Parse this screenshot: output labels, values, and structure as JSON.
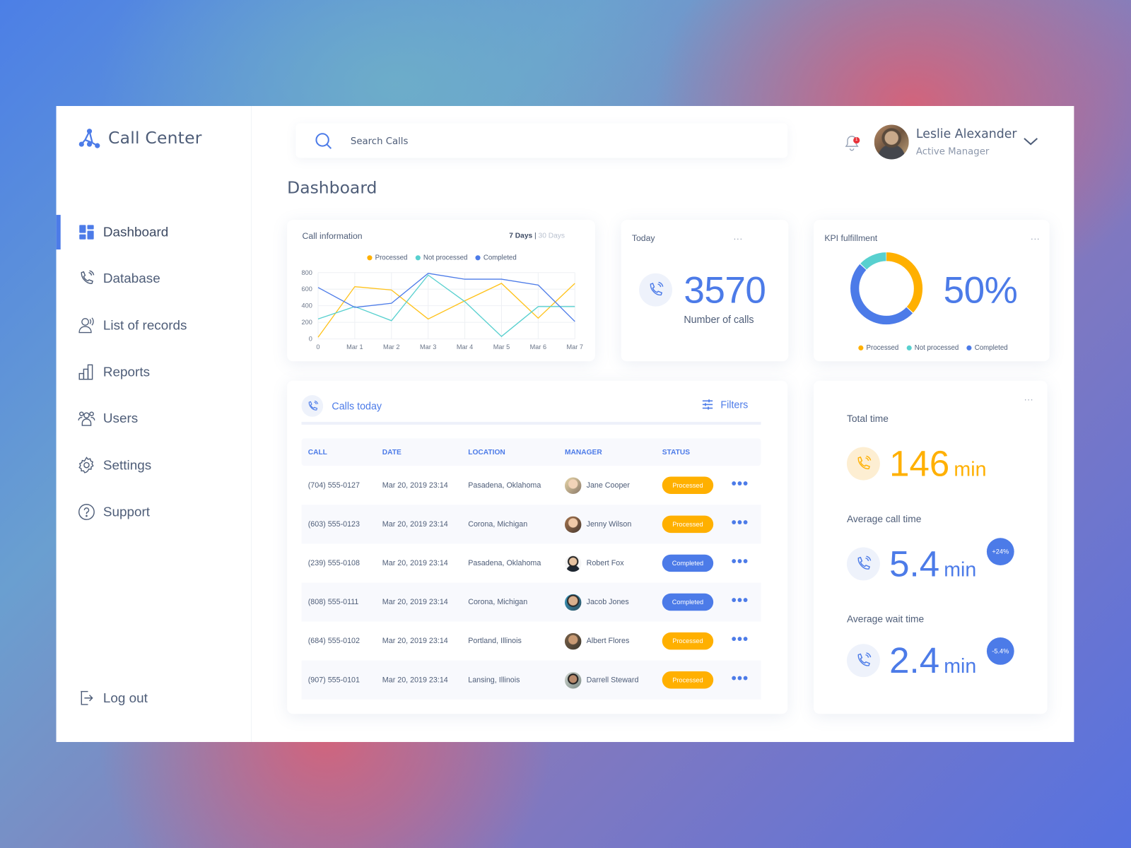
{
  "app": {
    "title": "Call Center"
  },
  "colors": {
    "accent": "#4c7be8",
    "processed": "#ffb000",
    "not_processed": "#58d0cf",
    "completed": "#4c7be8",
    "notification": "#e8333a"
  },
  "sidebar": {
    "items": [
      {
        "label": "Dashboard",
        "icon": "dashboard-icon",
        "active": true
      },
      {
        "label": "Database",
        "icon": "phone-icon"
      },
      {
        "label": "List of records",
        "icon": "voice-record-icon"
      },
      {
        "label": "Reports",
        "icon": "bar-chart-icon"
      },
      {
        "label": "Users",
        "icon": "users-icon"
      },
      {
        "label": "Settings",
        "icon": "gear-icon"
      },
      {
        "label": "Support",
        "icon": "help-icon"
      }
    ],
    "logout": "Log out"
  },
  "header": {
    "search_placeholder": "Search Calls",
    "notification_count": "1",
    "user_name": "Leslie Alexander",
    "user_role": "Active Manager"
  },
  "page": {
    "title": "Dashboard"
  },
  "call_info": {
    "title": "Call information",
    "range_active": "7 Days",
    "range_separator": "|",
    "range_other": "30 Days"
  },
  "today": {
    "title": "Today",
    "more": "...",
    "value": "3570",
    "label": "Number of calls"
  },
  "kpi": {
    "title": "KPI fulfillment",
    "more": "...",
    "value": "50%"
  },
  "legend": {
    "processed": "Processed",
    "not_processed": "Not processed",
    "completed": "Completed"
  },
  "calls_today": {
    "title": "Calls today",
    "filters": "Filters",
    "columns": [
      "CALL",
      "DATE",
      "LOCATION",
      "MANAGER",
      "STATUS"
    ],
    "rows": [
      {
        "call": "(704) 555-0127",
        "date": "Mar 20, 2019 23:14",
        "location": "Pasadena, Oklahoma",
        "manager": "Jane Cooper",
        "status": "Processed"
      },
      {
        "call": "(603) 555-0123",
        "date": "Mar 20, 2019 23:14",
        "location": "Corona, Michigan",
        "manager": "Jenny Wilson",
        "status": "Processed"
      },
      {
        "call": "(239) 555-0108",
        "date": "Mar 20, 2019 23:14",
        "location": "Pasadena, Oklahoma",
        "manager": "Robert Fox",
        "status": "Completed"
      },
      {
        "call": "(808) 555-0111",
        "date": "Mar 20, 2019 23:14",
        "location": "Corona, Michigan",
        "manager": "Jacob Jones",
        "status": "Completed"
      },
      {
        "call": "(684) 555-0102",
        "date": "Mar 20, 2019 23:14",
        "location": "Portland, Illinois",
        "manager": "Albert Flores",
        "status": "Processed"
      },
      {
        "call": "(907) 555-0101",
        "date": "Mar 20, 2019 23:14",
        "location": "Lansing, Illinois",
        "manager": "Darrell Steward",
        "status": "Processed"
      }
    ],
    "row_action": "•••"
  },
  "time_stats": {
    "more": "...",
    "total": {
      "label": "Total time",
      "value": "146",
      "unit": "min"
    },
    "avg_call": {
      "label": "Average call time",
      "value": "5.4",
      "unit": "min",
      "delta": "+24%"
    },
    "avg_wait": {
      "label": "Average wait time",
      "value": "2.4",
      "unit": "min",
      "delta": "-5.4%"
    }
  },
  "chart_data": [
    {
      "type": "line",
      "title": "Call information",
      "categories": [
        "0",
        "Mar 1",
        "Mar 2",
        "Mar 3",
        "Mar 4",
        "Mar 5",
        "Mar 6",
        "Mar 7"
      ],
      "yticks": [
        0,
        200,
        400,
        600,
        800
      ],
      "ylim": [
        0,
        800
      ],
      "grid": true,
      "legend": "top-center",
      "series": [
        {
          "name": "Processed",
          "color": "#ffc21a",
          "values": [
            20,
            630,
            590,
            240,
            460,
            670,
            250,
            670
          ]
        },
        {
          "name": "Not processed",
          "color": "#58d0cf",
          "values": [
            240,
            390,
            220,
            770,
            450,
            30,
            390,
            390
          ]
        },
        {
          "name": "Completed",
          "color": "#4c7be8",
          "values": [
            620,
            380,
            430,
            790,
            720,
            720,
            650,
            210
          ]
        }
      ]
    },
    {
      "type": "pie",
      "title": "KPI fulfillment",
      "donut": true,
      "center_label": "50%",
      "legend": "bottom",
      "slices": [
        {
          "name": "Processed",
          "color": "#ffb000",
          "value": 37
        },
        {
          "name": "Completed",
          "color": "#4c7be8",
          "value": 50
        },
        {
          "name": "Not processed",
          "color": "#58d0cf",
          "value": 13
        }
      ]
    }
  ]
}
